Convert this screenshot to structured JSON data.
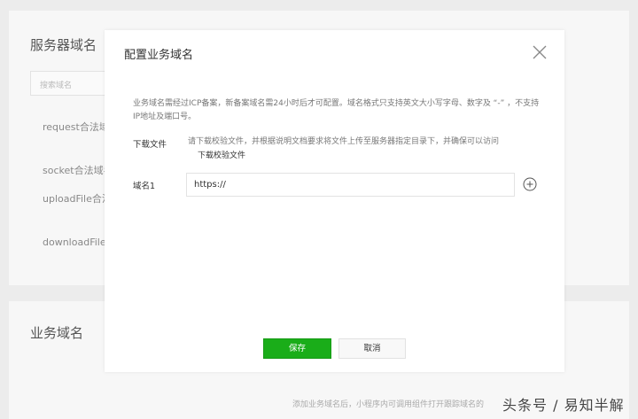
{
  "background": {
    "section_server_title": "服务器域名",
    "search_placeholder": "搜索域名",
    "rows": [
      "request合法域名",
      "socket合法域名",
      "uploadFile合法",
      "downloadFile合"
    ],
    "section_business_title": "业务域名",
    "footer_note": "添加业务域名后，小程序内可调用组件打开跟踪域名的"
  },
  "watermark": "头条号 / 易知半解",
  "modal": {
    "title": "配置业务域名",
    "description": "业务域名需经过ICP备案，新备案域名需24小时后才可配置。域名格式只支持英文大小写字母、数字及 “-” ，不支持IP地址及端口号。",
    "download": {
      "label": "下载文件",
      "text": "请下载校验文件，并根据说明文档要求将文件上传至服务器指定目录下，并确保可以访问",
      "link": "下载校验文件"
    },
    "domain": {
      "label": "域名1",
      "value": "https://"
    },
    "save_label": "保存",
    "cancel_label": "取消"
  },
  "colors": {
    "primary": "#1aad19",
    "overlay": "#ececec"
  }
}
